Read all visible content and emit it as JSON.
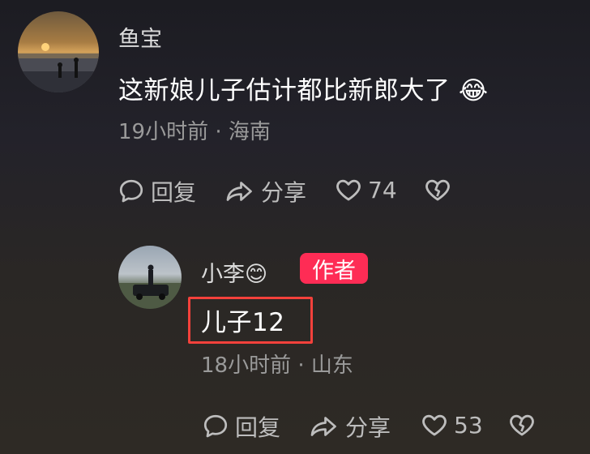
{
  "comment_main": {
    "username": "鱼宝",
    "text": "这新娘儿子估计都比新郎大了",
    "emoji": "😂",
    "time": "19小时前",
    "location": "海南",
    "reply_label": "回复",
    "share_label": "分享",
    "like_count": "74"
  },
  "comment_reply": {
    "username": "小李",
    "emoji": "😊",
    "badge": "作者",
    "text": "儿子12",
    "time": "18小时前",
    "location": "山东",
    "reply_label": "回复",
    "share_label": "分享",
    "like_count": "53"
  },
  "separator": "·",
  "colors": {
    "badge": "#fe2c55",
    "highlight_box": "#f4413b",
    "meta_text": "#9a9a9a"
  },
  "icons": [
    "comment-bubble-icon",
    "share-arrow-icon",
    "heart-icon",
    "broken-heart-icon"
  ]
}
